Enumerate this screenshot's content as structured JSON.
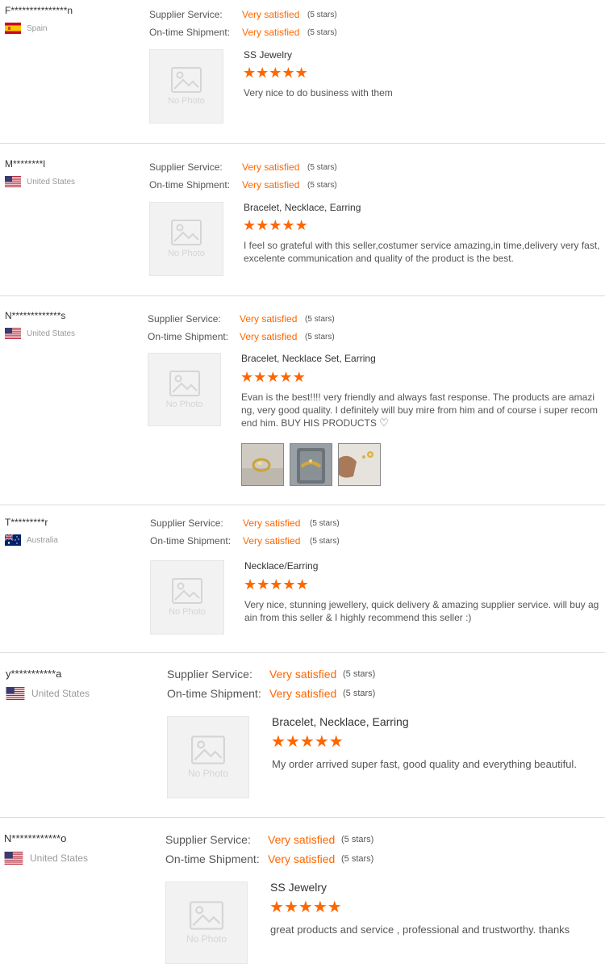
{
  "labels": {
    "supplier_service": "Supplier Service:",
    "ontime_shipment": "On-time Shipment:",
    "stars_suffix": "(5 stars)",
    "no_photo": "No Photo",
    "star_glyph": "★"
  },
  "accent_color": "#ff6600",
  "reviews": [
    {
      "user": "F***************n",
      "country": "Spain",
      "flag_icon": "spain-flag-icon",
      "supplier_service": "Very satisfied",
      "ontime_shipment": "Very satisfied",
      "rating_stars": 5,
      "product": "SS Jewelry",
      "feedback": "Very nice to do business with them"
    },
    {
      "user": "M********l",
      "country": "United States",
      "flag_icon": "us-flag-icon",
      "supplier_service": "Very satisfied",
      "ontime_shipment": "Very satisfied",
      "rating_stars": 5,
      "product": "Bracelet, Necklace, Earring",
      "feedback": "I feel so grateful with this seller,costumer service amazing,in time,delivery very fast,excelente communication and quality of the product is the best."
    },
    {
      "user": "N*************s",
      "country": "United States",
      "flag_icon": "us-flag-icon",
      "supplier_service": "Very satisfied",
      "ontime_shipment": "Very satisfied",
      "rating_stars": 5,
      "product": "Bracelet, Necklace Set, Earring",
      "feedback": "Evan is the best!!!! very friendly and always fast response. The products are amazing, very good quality. I definitely will buy mire from him and of course i super recomend him. BUY HIS PRODUCTS",
      "photos": [
        "gold-ring-photo",
        "gold-bracelet-photo",
        "gold-earring-photo"
      ]
    },
    {
      "user": "T*********r",
      "country": "Australia",
      "flag_icon": "australia-flag-icon",
      "supplier_service": "Very satisfied",
      "ontime_shipment": "Very satisfied",
      "rating_stars": 5,
      "product": "Necklace/Earring",
      "feedback": "Very nice, stunning jewellery, quick delivery & amazing supplier service. will buy again from this seller & I highly recommend this seller :)"
    },
    {
      "user": "y***********a",
      "country": "United States",
      "flag_icon": "us-flag-icon",
      "supplier_service": "Very satisfied",
      "ontime_shipment": "Very satisfied",
      "rating_stars": 5,
      "product": "Bracelet, Necklace, Earring",
      "feedback": "My order arrived super fast, good quality and everything beautiful."
    },
    {
      "user": "N************o",
      "country": "United States",
      "flag_icon": "us-flag-icon",
      "supplier_service": "Very satisfied",
      "ontime_shipment": "Very satisfied",
      "rating_stars": 5,
      "product": "SS Jewelry",
      "feedback": "great products and service , professional and trustworthy. thanks"
    }
  ]
}
